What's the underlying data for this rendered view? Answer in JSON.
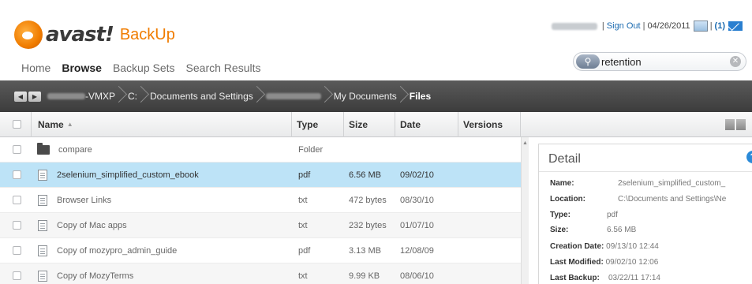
{
  "app": {
    "logo_word": "avast!",
    "logo_product": "BackUp"
  },
  "top_right": {
    "sign_out": "Sign Out",
    "date": "04/26/2011",
    "messages": "(1)"
  },
  "nav": {
    "items": [
      "Home",
      "Browse",
      "Backup Sets",
      "Search Results"
    ],
    "active": "Browse"
  },
  "search": {
    "value": "retention"
  },
  "breadcrumb": {
    "machine_suffix": "-VMXP",
    "drive": "C:",
    "folder1": "Documents and Settings",
    "folder2": "My Documents",
    "current": "Files"
  },
  "table": {
    "headers": {
      "name": "Name",
      "type": "Type",
      "size": "Size",
      "date": "Date",
      "versions": "Versions"
    },
    "rows": [
      {
        "name": "compare",
        "type": "Folder",
        "size": "",
        "date": "",
        "kind": "folder"
      },
      {
        "name": "2selenium_simplified_custom_ebook",
        "type": "pdf",
        "size": "6.56 MB",
        "date": "09/02/10",
        "kind": "file",
        "selected": true
      },
      {
        "name": "Browser Links",
        "type": "txt",
        "size": "472 bytes",
        "date": "08/30/10",
        "kind": "file"
      },
      {
        "name": "Copy of Mac apps",
        "type": "txt",
        "size": "232 bytes",
        "date": "01/07/10",
        "kind": "file"
      },
      {
        "name": "Copy of mozypro_admin_guide",
        "type": "pdf",
        "size": "3.13 MB",
        "date": "12/08/09",
        "kind": "file"
      },
      {
        "name": "Copy of MozyTerms",
        "type": "txt",
        "size": "9.99 KB",
        "date": "08/06/10",
        "kind": "file"
      }
    ]
  },
  "detail": {
    "title": "Detail",
    "name_label": "Name:",
    "name_value": "2selenium_simplified_custom_",
    "location_label": "Location:",
    "location_value": "C:\\Documents and Settings\\Ne",
    "type_label": "Type:",
    "type_value": "pdf",
    "size_label": "Size:",
    "size_value": "6.56 MB",
    "creation_label": "Creation Date:",
    "creation_value": "09/13/10 12:44",
    "modified_label": "Last Modified:",
    "modified_value": "09/02/10 12:06",
    "backup_label": "Last Backup:",
    "backup_value": "03/22/11 17:14"
  }
}
